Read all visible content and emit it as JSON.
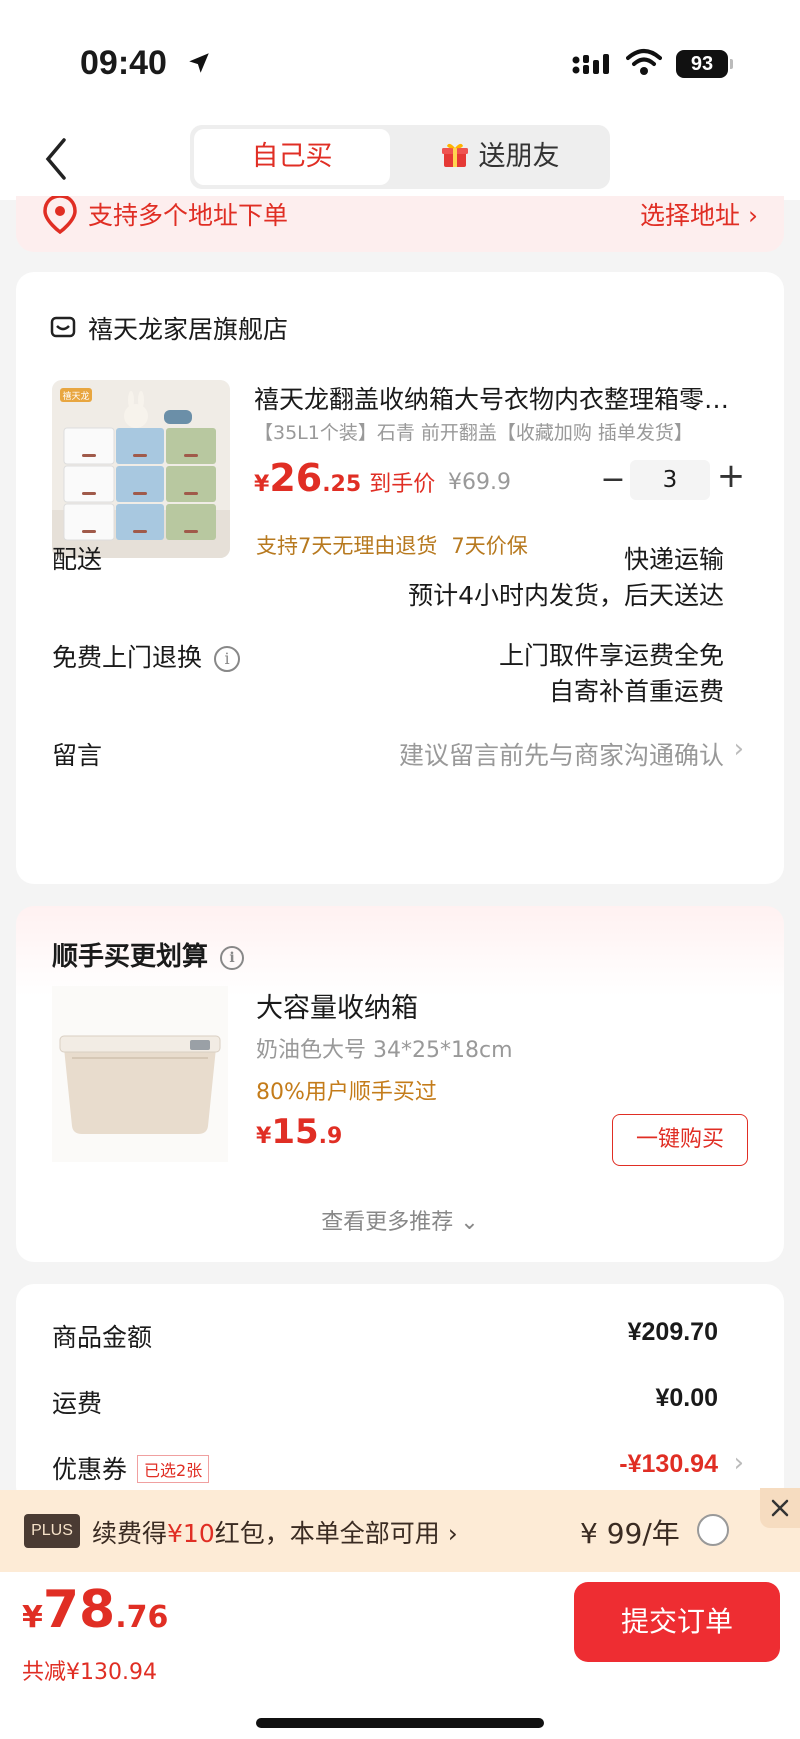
{
  "status_bar": {
    "time": "09:40",
    "battery": "93"
  },
  "nav": {
    "tab_self": "自己买",
    "tab_gift": "送朋友"
  },
  "address": {
    "text": "支持多个地址下单",
    "choose": "选择地址"
  },
  "order": {
    "shop_name": "禧天龙家居旗舰店",
    "product": {
      "image_brand": "禧天龙",
      "title": "禧天龙翻盖收纳箱大号衣物内衣整理箱零…",
      "spec": "【35L1个装】石青 前开翻盖【收藏加购 插单发货】",
      "price_symbol": "¥",
      "price_int": "26",
      "price_dec": ".25",
      "price_tag": "到手价",
      "original_price": "¥69.9",
      "quantity": "3",
      "minus": "−",
      "plus": "+",
      "guarantees": [
        "支持7天无理由退货",
        "7天价保"
      ]
    },
    "delivery": {
      "label": "配送",
      "method": "快递运输",
      "eta": "预计4小时内发货，后天送达"
    },
    "return": {
      "label": "免费上门退换",
      "line1": "上门取件享运费全免",
      "line2": "自寄补首重运费"
    },
    "note": {
      "label": "留言",
      "placeholder": "建议留言前先与商家沟通确认"
    }
  },
  "recommend": {
    "title": "顺手买更划算",
    "item_title": "大容量收纳箱",
    "item_spec": "奶油色大号 34*25*18cm",
    "buyers": "80%用户顺手买过",
    "price_symbol": "¥",
    "price_int": "15",
    "price_dec": ".9",
    "buy_button": "一键购买",
    "more": "查看更多推荐"
  },
  "summary": {
    "goods_label": "商品金额",
    "goods_value": "¥209.70",
    "shipping_label": "运费",
    "shipping_value": "¥0.00",
    "coupon_label": "优惠券",
    "coupon_badge": "已选2张",
    "coupon_value": "-¥130.94"
  },
  "plus": {
    "badge": "PLUS",
    "text_prefix": "续费得",
    "text_amount": "¥10",
    "text_suffix": "红包，本单全部可用",
    "price": "¥ 99/年"
  },
  "bottom": {
    "price_symbol": "¥",
    "price_int": "78",
    "price_dec": ".76",
    "saved": "共减¥130.94",
    "submit": "提交订单"
  }
}
